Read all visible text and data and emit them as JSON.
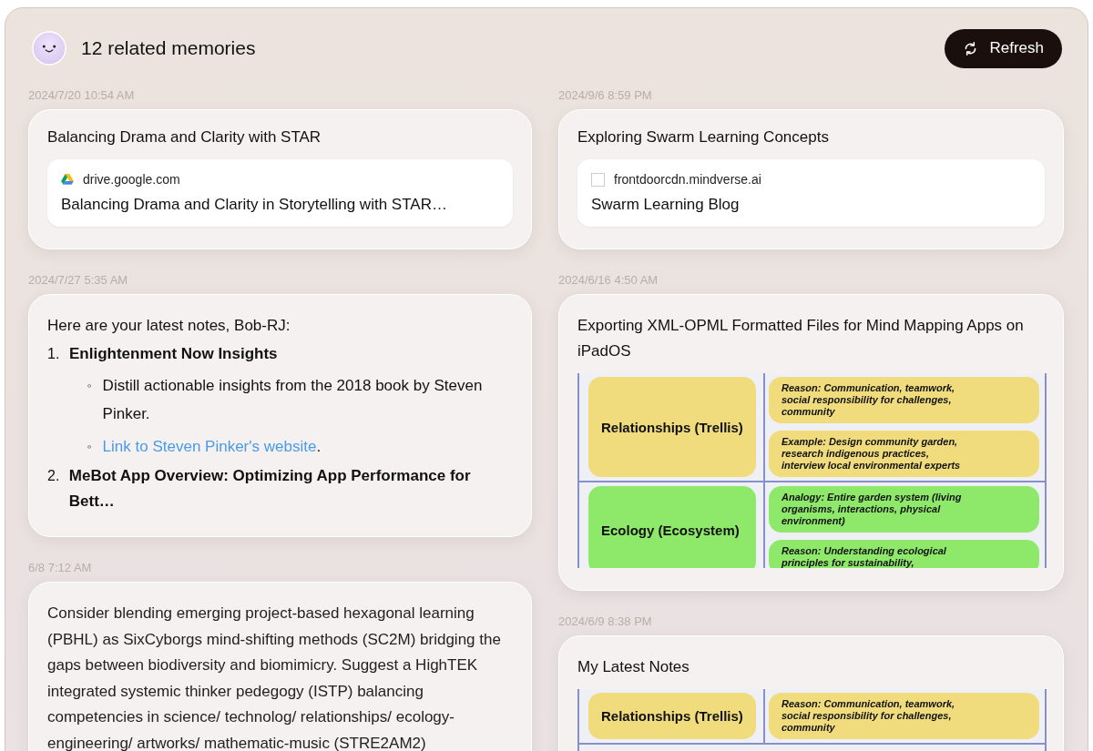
{
  "header": {
    "title": "12 related memories",
    "refresh_label": "Refresh"
  },
  "columns": [
    [
      {
        "date": "2024/7/20 10:54 AM",
        "kind": "link",
        "title": "Balancing Drama and Clarity with STAR",
        "source": {
          "kind": "drive",
          "domain": "drive.google.com",
          "title": "Balancing Drama and Clarity in Storytelling with STAR…"
        }
      },
      {
        "date": "2024/7/27 5:35 AM",
        "kind": "notes",
        "intro": "Here are your latest notes, Bob-RJ:",
        "items": [
          {
            "number": "1.",
            "title": "Enlightenment Now Insights",
            "bullets": [
              {
                "marker": "◦",
                "kind": "text",
                "text": "Distill actionable insights from the 2018 book by Steven Pinker."
              },
              {
                "marker": "◦",
                "kind": "link",
                "text": "Link to Steven Pinker's website",
                "after": "."
              }
            ]
          },
          {
            "number": "2.",
            "title": "MeBot App Overview: Optimizing App Performance for Bett…"
          }
        ]
      },
      {
        "date": "6/8 7:12 AM",
        "kind": "text",
        "text": "Consider blending emerging project-based hexagonal learning (PBHL) as SixCyborgs mind-shifting methods (SC2M) bridging the gaps between biodiversity and biomimicry. Suggest a HighTEK integrated systemic thinker pedegogy (ISTP) balancing competencies in science/ technolog/ relationships/ ecology-engineering/ artworks/ mathematic-music (STRE2AM2)"
      }
    ],
    [
      {
        "date": "2024/9/6 8:59 PM",
        "kind": "link",
        "title": "Exploring Swarm Learning Concepts",
        "source": {
          "kind": "generic",
          "domain": "frontdoorcdn.mindverse.ai",
          "title": "Swarm Learning Blog"
        }
      },
      {
        "date": "2024/6/16 4:50 AM",
        "kind": "image",
        "title": "Exporting XML-OPML Formatted Files for Mind Mapping Apps on iPadOS",
        "diagram": [
          {
            "label": "Relationships (Trellis)",
            "color": "#f0dc7c",
            "cells": [
              "Reason: Communication, teamwork, social responsibility for challenges, community",
              "Example: Design community garden, research indigenous practices, interview local environmental experts"
            ]
          },
          {
            "label": "Ecology (Ecosystem)",
            "color": "#8ee96a",
            "cells": [
              "Analogy: Entire garden system (living organisms, interactions, physical environment)",
              "Reason: Understanding ecological principles for sustainability,"
            ]
          }
        ]
      },
      {
        "date": "2024/6/9 8:38 PM",
        "kind": "image",
        "title": "My Latest Notes",
        "diagram": [
          {
            "label": "Relationships (Trellis)",
            "color": "#f0dc7c",
            "cells": [
              "Reason: Communication, teamwork, social responsibility for challenges, community"
            ]
          }
        ]
      }
    ]
  ]
}
